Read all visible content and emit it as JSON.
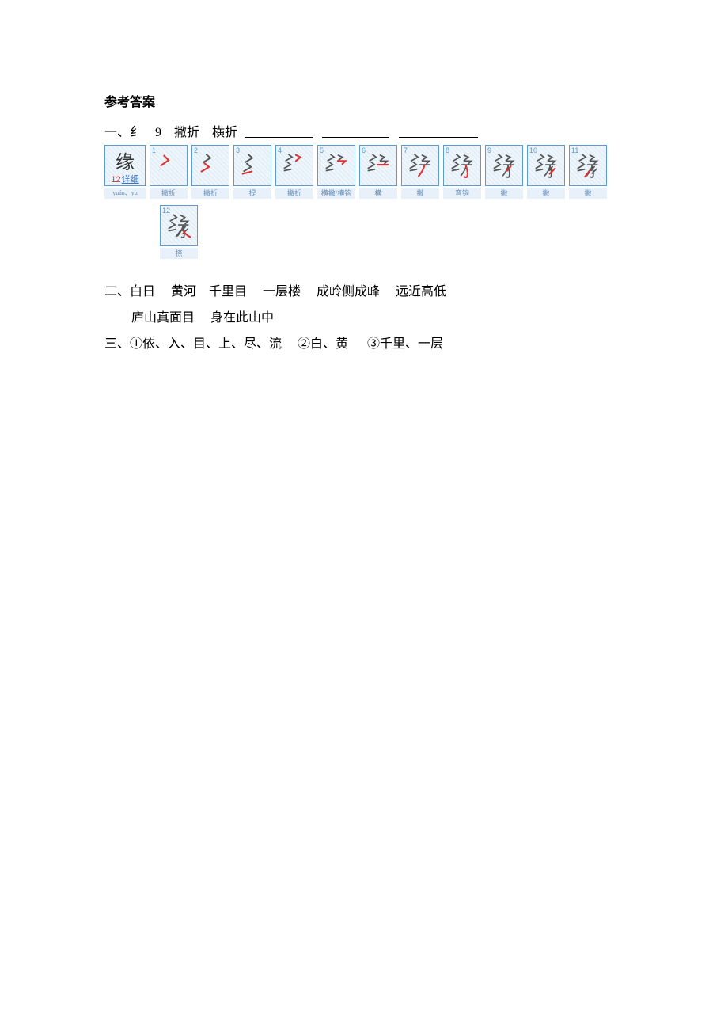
{
  "heading": "参考答案",
  "q1_text": "一、纟　9　撇折　横折",
  "main_box": {
    "char": "缘",
    "count": "12",
    "detail": "详细",
    "pinyin": "yuán、yu"
  },
  "stroke_boxes": [
    {
      "num": "1",
      "label": "撇折"
    },
    {
      "num": "2",
      "label": "撇折"
    },
    {
      "num": "3",
      "label": "提"
    },
    {
      "num": "4",
      "label": "撇折"
    },
    {
      "num": "5",
      "label": "横撇/横钩"
    },
    {
      "num": "6",
      "label": "横"
    },
    {
      "num": "7",
      "label": "撇"
    },
    {
      "num": "8",
      "label": "弯钩"
    },
    {
      "num": "9",
      "label": "撇"
    },
    {
      "num": "10",
      "label": "撇"
    },
    {
      "num": "11",
      "label": "撇"
    },
    {
      "num": "12",
      "label": "捺"
    }
  ],
  "q2_line1": "二、白日　 黄河　千里目　 一层楼　 成岭侧成峰　 远近高低",
  "q2_line2": "庐山真面目　 身在此山中",
  "q3_line": "三、①依、入、目、上、尽、流　 ②白、黄　  ③千里、一层"
}
